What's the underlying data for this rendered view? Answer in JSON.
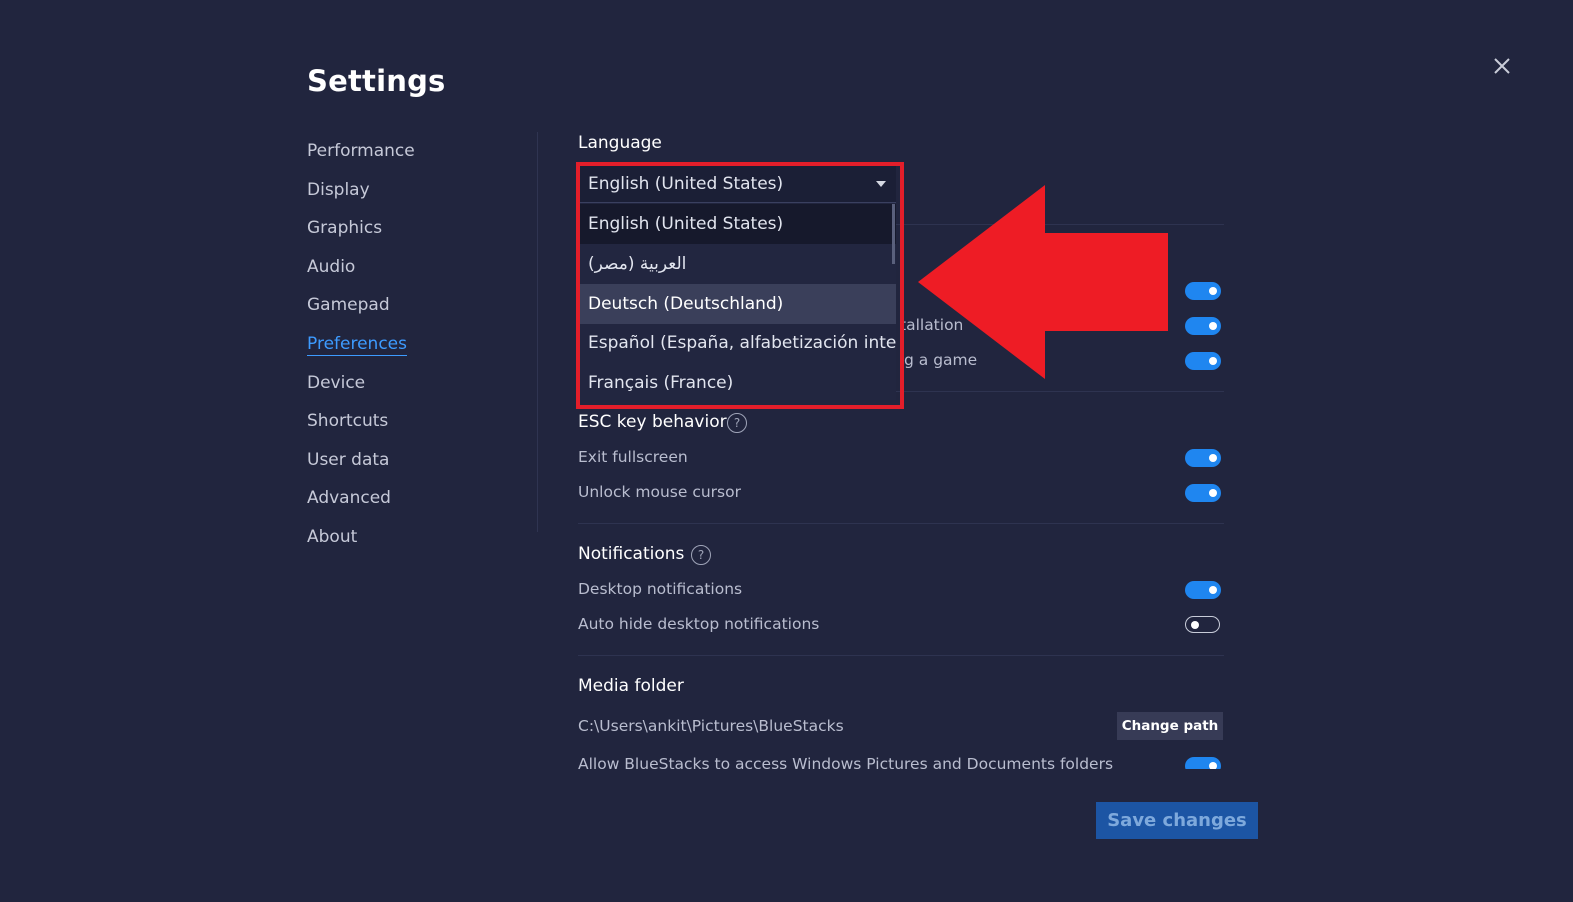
{
  "page_title": "Settings",
  "nav_items": [
    "Performance",
    "Display",
    "Graphics",
    "Audio",
    "Gamepad",
    "Preferences",
    "Device",
    "Shortcuts",
    "User data",
    "Advanced",
    "About"
  ],
  "active_nav": "Preferences",
  "language": {
    "heading": "Language",
    "selected": "English (United States)",
    "options": [
      "English (United States)",
      "العربية (مصر)",
      "Deutsch (Deutschland)",
      "Español (España, alfabetización inter…",
      "Français (France)"
    ],
    "hovered_option": "Deutsch (Deutschland)"
  },
  "partial_rows": [
    {
      "visible_text": "tallation",
      "toggle": true
    },
    {
      "visible_text": "g a game",
      "toggle": true
    }
  ],
  "hidden_toggle_top": true,
  "esc": {
    "heading": "ESC key behavior",
    "help_icon": "question-circle-icon",
    "rows": [
      {
        "label": "Exit fullscreen",
        "toggle": true
      },
      {
        "label": "Unlock mouse cursor",
        "toggle": true
      }
    ]
  },
  "notifications": {
    "heading": "Notifications",
    "help_icon": "question-circle-icon",
    "rows": [
      {
        "label": "Desktop notifications",
        "toggle": true
      },
      {
        "label": "Auto hide desktop notifications",
        "toggle": false
      }
    ]
  },
  "media": {
    "heading": "Media folder",
    "path": "C:\\Users\\ankit\\Pictures\\BlueStacks",
    "change_path_label": "Change path",
    "allow_label": "Allow BlueStacks to access Windows Pictures and Documents folders",
    "allow_toggle": true
  },
  "save_label": "Save changes",
  "colors": {
    "background": "#21253e",
    "accent": "#1f86f0",
    "highlight_red": "#e31e2a",
    "active_link": "#3d9bff"
  },
  "icons": {
    "close": "close-icon",
    "dropdown": "caret-down-icon",
    "annotation": "red-arrow-left"
  }
}
